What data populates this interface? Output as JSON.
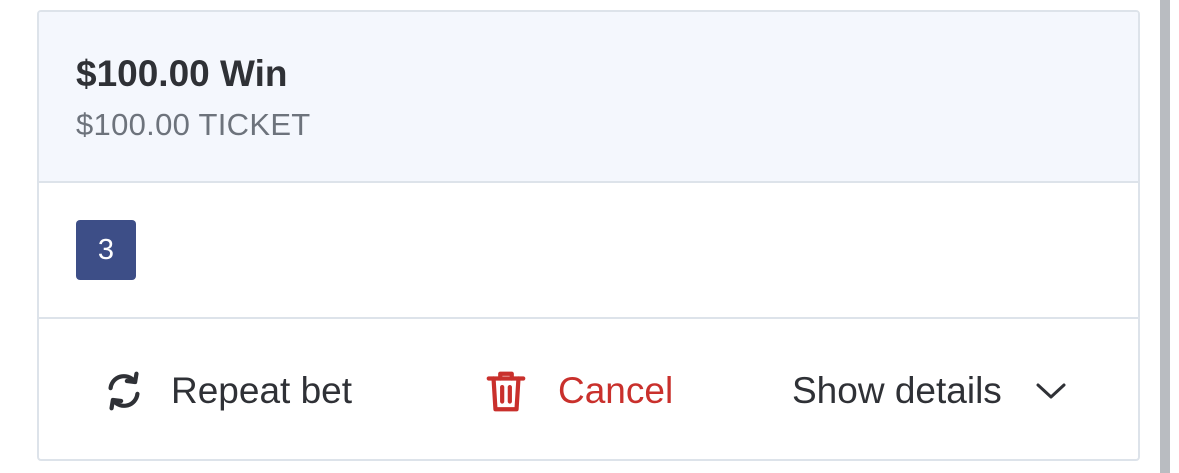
{
  "bet": {
    "title": "$100.00 Win",
    "ticket": "$100.00 TICKET",
    "selection_number": "3"
  },
  "actions": {
    "repeat_label": "Repeat bet",
    "cancel_label": "Cancel",
    "details_label": "Show details"
  },
  "icons": {
    "repeat": "repeat-arrows-icon",
    "cancel": "trash-icon",
    "details": "chevron-down-icon"
  },
  "colors": {
    "header_bg": "#f4f7fd",
    "badge_bg": "#3d4e87",
    "cancel": "#c9302c",
    "text": "#2f3136",
    "muted": "#6d737c",
    "border": "#dde3ea"
  }
}
